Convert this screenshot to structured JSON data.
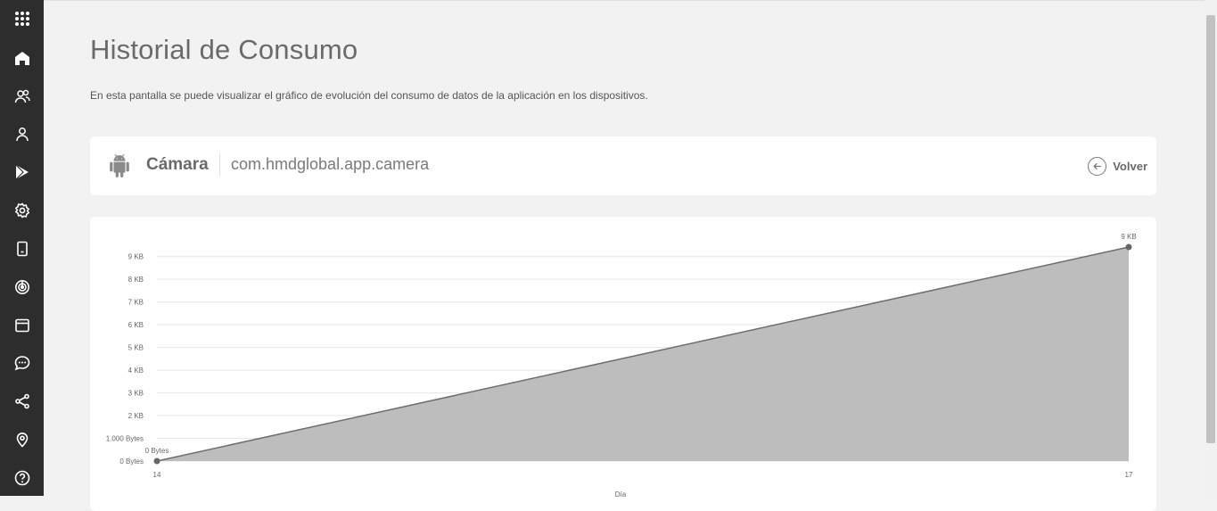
{
  "sidebar": {
    "items": [
      {
        "icon": "apps-grid-icon",
        "name": "sidebar-item-apps-menu"
      },
      {
        "icon": "home-icon",
        "name": "sidebar-item-home"
      },
      {
        "icon": "users-icon",
        "name": "sidebar-item-users"
      },
      {
        "icon": "user-icon",
        "name": "sidebar-item-user"
      },
      {
        "icon": "play-store-icon",
        "name": "sidebar-item-applications"
      },
      {
        "icon": "gear-icon",
        "name": "sidebar-item-settings"
      },
      {
        "icon": "device-icon",
        "name": "sidebar-item-devices"
      },
      {
        "icon": "radar-icon",
        "name": "sidebar-item-tracking"
      },
      {
        "icon": "window-icon",
        "name": "sidebar-item-browser"
      },
      {
        "icon": "chat-icon",
        "name": "sidebar-item-messages"
      },
      {
        "icon": "share-icon",
        "name": "sidebar-item-share"
      },
      {
        "icon": "location-pin-icon",
        "name": "sidebar-item-location"
      },
      {
        "icon": "help-icon",
        "name": "sidebar-item-help"
      }
    ]
  },
  "header": {
    "title": "Historial de Consumo",
    "description": "En esta pantalla se puede visualizar el gráfico de evolución del consumo de datos de la aplicación en los dispositivos."
  },
  "app": {
    "name": "Cámara",
    "package": "com.hmdglobal.app.camera",
    "back_label": "Volver",
    "platform_icon": "android-icon"
  },
  "chart_data": {
    "type": "area",
    "title": "",
    "xlabel": "Día",
    "ylabel": "",
    "x": [
      "14",
      "17"
    ],
    "series": [
      {
        "values": [
          0,
          9420
        ]
      }
    ],
    "point_labels": [
      "0 Bytes",
      "9 KB"
    ],
    "y_ticks": [
      {
        "value": 0,
        "label": "0 Bytes"
      },
      {
        "value": 1000,
        "label": "1.000 Bytes"
      },
      {
        "value": 2000,
        "label": "2 KB"
      },
      {
        "value": 3000,
        "label": "3 KB"
      },
      {
        "value": 4000,
        "label": "4 KB"
      },
      {
        "value": 5000,
        "label": "5 KB"
      },
      {
        "value": 6000,
        "label": "6 KB"
      },
      {
        "value": 7000,
        "label": "7 KB"
      },
      {
        "value": 8000,
        "label": "8 KB"
      },
      {
        "value": 9000,
        "label": "9 KB"
      }
    ],
    "ylim": [
      0,
      9420
    ],
    "grid": true,
    "colors": {
      "fill": "#bdbdbd",
      "line": "#6e6e6e",
      "grid": "#e6e6e6"
    }
  }
}
